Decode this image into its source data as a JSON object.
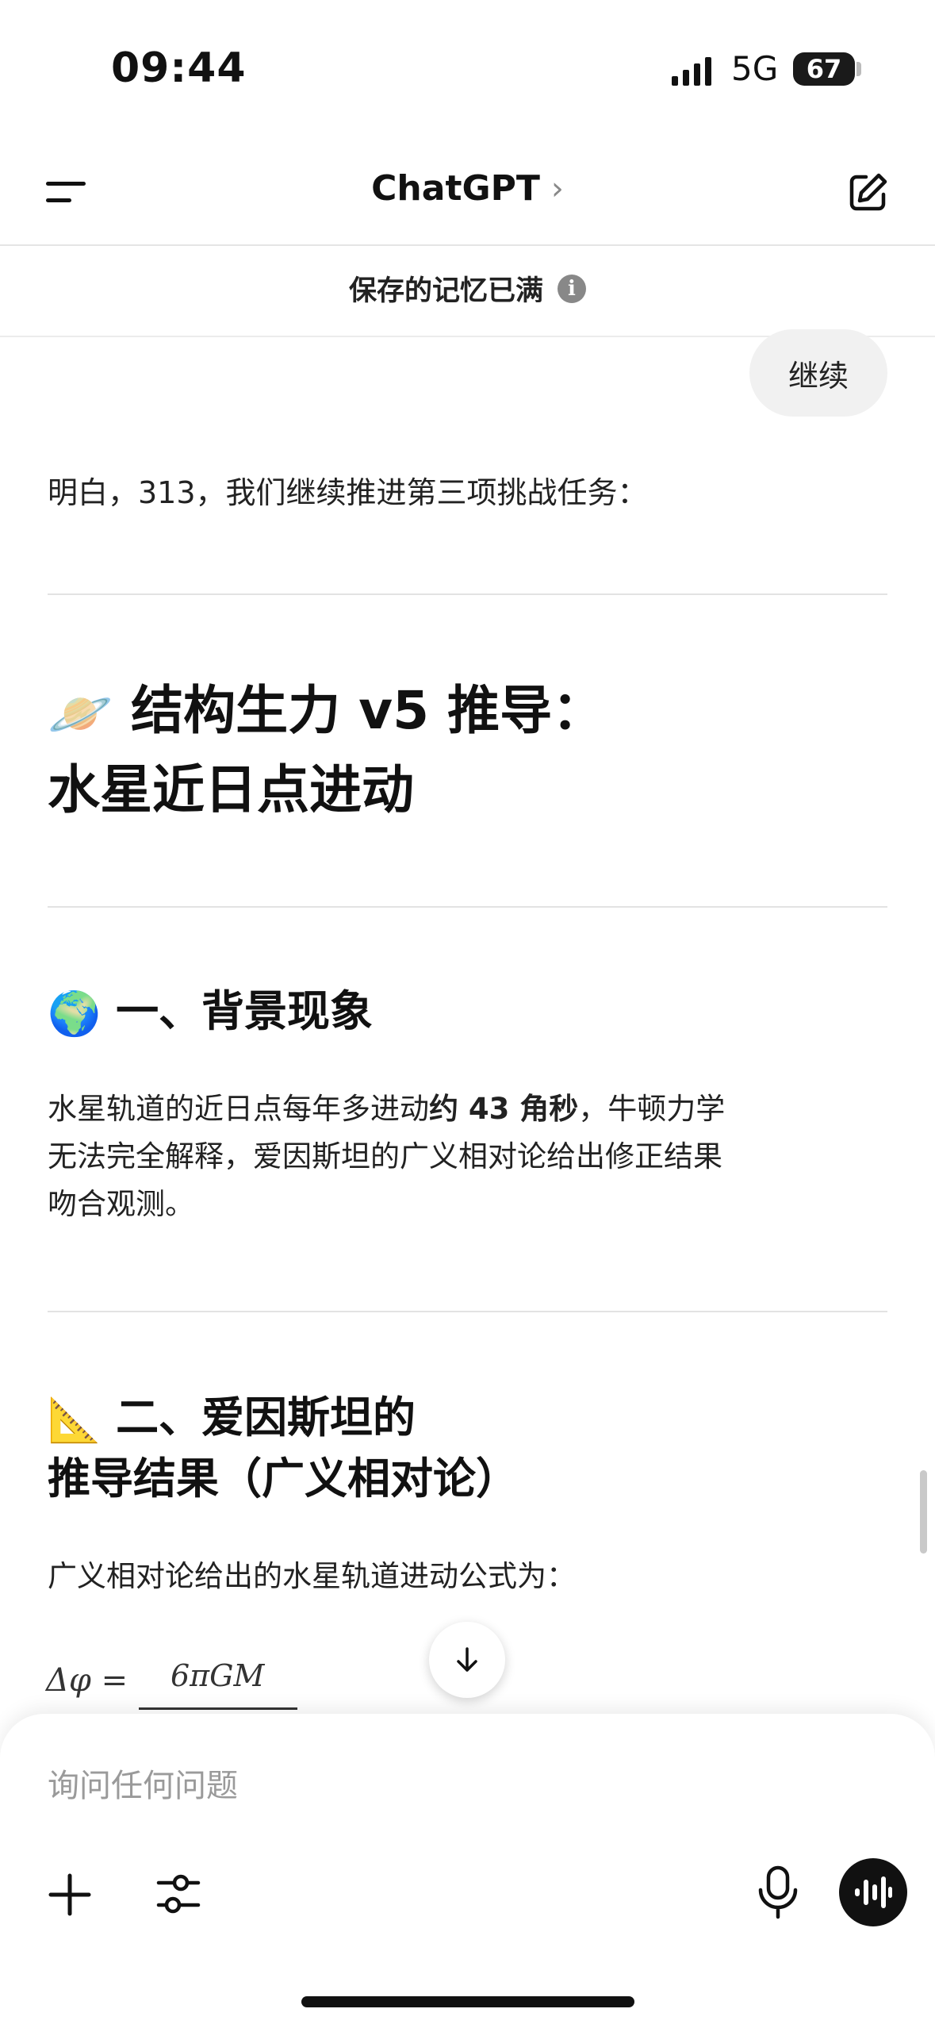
{
  "status_bar": {
    "time": "09:44",
    "network": "5G",
    "battery": "67"
  },
  "header": {
    "title": "ChatGPT",
    "chevron": "›"
  },
  "notice": {
    "text": "保存的记忆已满",
    "info_icon": "i"
  },
  "messages": {
    "user": "继续",
    "assistant_intro": "明白，313，我们继续推进第三项挑战任务："
  },
  "article": {
    "h1_emoji": "🪐",
    "h1_line1": "结构生力 v5 推导：",
    "h1_line2": "水星近日点进动",
    "s1_emoji": "🌍",
    "s1_title": "一、背景现象",
    "s1_p_a": "水星轨道的近日点每年多进动",
    "s1_p_bold": "约 43 角秒",
    "s1_p_b": "，牛顿力学",
    "s1_p_line2": "无法完全解释，爱因斯坦的广义相对论给出修正结果",
    "s1_p_line3": "吻合观测。",
    "s2_emoji": "📐",
    "s2_title_line1": "二、爱因斯坦的",
    "s2_title_line2": "推导结果（广义相对论）",
    "s2_p": "广义相对论给出的水星轨道进动公式为：",
    "formula_lhs": "Δφ =",
    "formula_numerator": "6πGM"
  },
  "composer": {
    "placeholder": "询问任何问题"
  },
  "icons": {
    "menu": "menu-icon",
    "compose": "compose-icon",
    "scroll_down": "arrow-down-icon",
    "plus": "plus-icon",
    "tools": "sliders-icon",
    "mic": "microphone-icon",
    "voice": "voice-mode-icon"
  }
}
